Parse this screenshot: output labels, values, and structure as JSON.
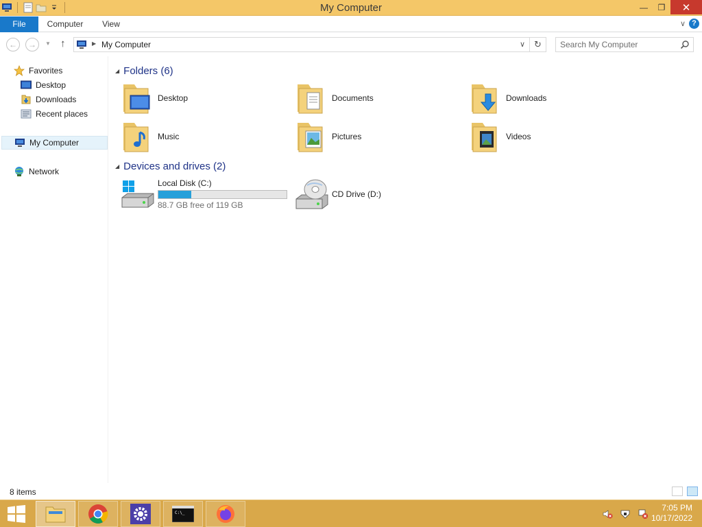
{
  "window": {
    "title": "My Computer",
    "minimize_glyph": "—",
    "restore_glyph": "❐",
    "close_glyph": "✕"
  },
  "ribbon": {
    "tabs": [
      {
        "label": "File"
      },
      {
        "label": "Computer"
      },
      {
        "label": "View"
      }
    ],
    "collapse_glyph": "∨",
    "help_glyph": "?"
  },
  "nav": {
    "back_glyph": "←",
    "forward_glyph": "→",
    "up_glyph": "↑",
    "address_path": "My Computer",
    "refresh_glyph": "↻",
    "search_placeholder": "Search My Computer"
  },
  "sidebar": {
    "favorites_label": "Favorites",
    "favorites": [
      {
        "label": "Desktop",
        "icon": "desktop-icon"
      },
      {
        "label": "Downloads",
        "icon": "downloads-icon"
      },
      {
        "label": "Recent places",
        "icon": "recent-places-icon"
      }
    ],
    "computer_label": "My Computer",
    "network_label": "Network"
  },
  "folders_group": {
    "header": "Folders (6)",
    "items": [
      {
        "label": "Desktop",
        "icon": "desktop-folder-icon"
      },
      {
        "label": "Documents",
        "icon": "documents-folder-icon"
      },
      {
        "label": "Downloads",
        "icon": "downloads-folder-icon"
      },
      {
        "label": "Music",
        "icon": "music-folder-icon"
      },
      {
        "label": "Pictures",
        "icon": "pictures-folder-icon"
      },
      {
        "label": "Videos",
        "icon": "videos-folder-icon"
      }
    ]
  },
  "drives_group": {
    "header": "Devices and drives (2)",
    "items": [
      {
        "label": "Local Disk (C:)",
        "free_text": "88.7 GB free of 119 GB",
        "used_fraction": 0.255,
        "icon": "hard-drive-icon"
      },
      {
        "label": "CD Drive (D:)",
        "icon": "cd-drive-icon"
      }
    ]
  },
  "status": {
    "item_count": "8 items"
  },
  "taskbar": {
    "items": [
      {
        "name": "file-explorer-icon"
      },
      {
        "name": "chrome-icon"
      },
      {
        "name": "settings-icon"
      },
      {
        "name": "command-prompt-icon"
      },
      {
        "name": "firefox-icon"
      }
    ],
    "time": "7:05 PM",
    "date": "10/17/2022"
  },
  "colors": {
    "titlebar": "#f4c768",
    "accent": "#1979ca",
    "taskbar": "#d9a84a",
    "close": "#c7392d",
    "progress": "#26a0da"
  }
}
